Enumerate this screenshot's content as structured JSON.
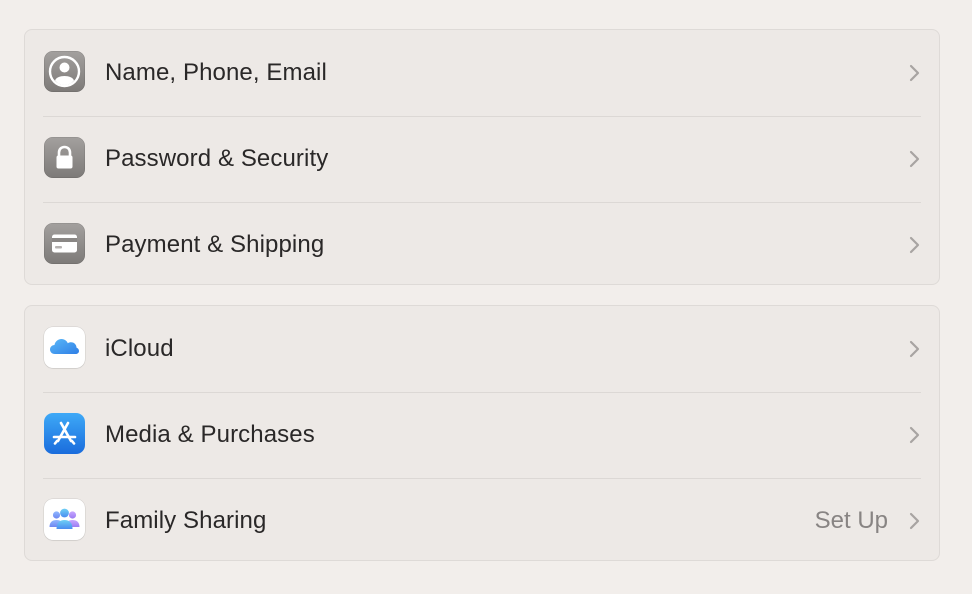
{
  "groups": [
    {
      "rows": [
        {
          "label": "Name, Phone, Email",
          "icon": "person-circle-icon"
        },
        {
          "label": "Password & Security",
          "icon": "lock-icon"
        },
        {
          "label": "Payment & Shipping",
          "icon": "credit-card-icon"
        }
      ]
    },
    {
      "rows": [
        {
          "label": "iCloud",
          "icon": "icloud-icon"
        },
        {
          "label": "Media & Purchases",
          "icon": "app-store-icon"
        },
        {
          "label": "Family Sharing",
          "icon": "family-sharing-icon",
          "value": "Set Up"
        }
      ]
    }
  ],
  "colors": {
    "background": "#f2eeeb",
    "group_background": "#ede9e6",
    "text": "#2a2828",
    "secondary_text": "#888483",
    "chevron": "#a8a4a2"
  }
}
